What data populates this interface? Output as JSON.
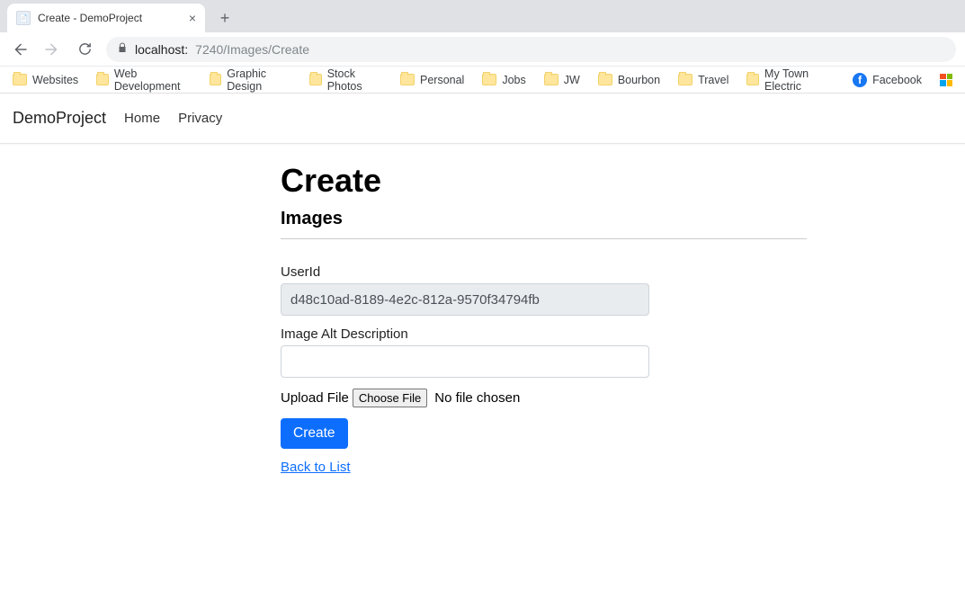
{
  "browser": {
    "tab_title": "Create - DemoProject",
    "url_host": "localhost:",
    "url_port_path": "7240/Images/Create",
    "bookmarks": [
      "Websites",
      "Web Development",
      "Graphic Design",
      "Stock Photos",
      "Personal",
      "Jobs",
      "JW",
      "Bourbon",
      "Travel",
      "My Town Electric"
    ],
    "bookmark_facebook": "Facebook"
  },
  "app_nav": {
    "brand": "DemoProject",
    "links": [
      "Home",
      "Privacy"
    ]
  },
  "page": {
    "heading": "Create",
    "subheading": "Images",
    "userid_label": "UserId",
    "userid_value": "d48c10ad-8189-4e2c-812a-9570f34794fb",
    "alt_label": "Image Alt Description",
    "alt_value": "",
    "upload_label": "Upload File",
    "choose_file_btn": "Choose File",
    "no_file_text": "No file chosen",
    "submit_label": "Create",
    "back_link": "Back to List"
  }
}
